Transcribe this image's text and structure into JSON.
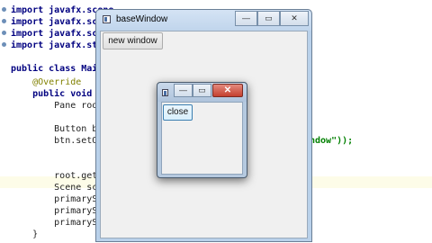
{
  "editor": {
    "lines": [
      "import javafx.scene",
      "import javafx.scene",
      "import javafx.scene",
      "import javafx.stage",
      "",
      "public class Main e",
      "    @Override",
      "    public void star",
      "        Pane root",
      "",
      "        Button btn",
      "        btn.setOnA",
      "",
      "",
      "        root.getCh",
      "        Scene scene",
      "        primarySta",
      "        primarySta",
      "        primarySta",
      "    }"
    ],
    "overflow_text": "ndow\"));"
  },
  "base_window": {
    "title": "baseWindow",
    "button_label": "new window",
    "minimize_glyph": "—",
    "maximize_glyph": "▭",
    "close_glyph": "✕"
  },
  "child_window": {
    "button_label": "close",
    "minimize_glyph": "—",
    "maximize_glyph": "▭",
    "close_glyph": "✕"
  }
}
